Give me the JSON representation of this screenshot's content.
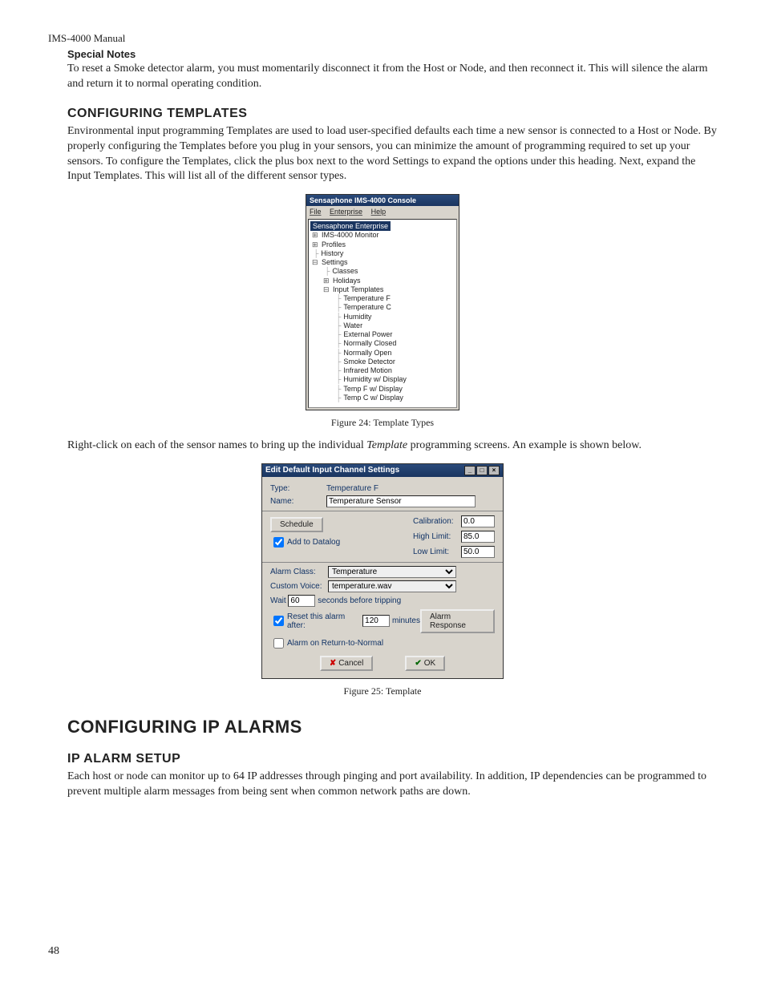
{
  "manualTitle": "IMS-4000 Manual",
  "specialNotes": {
    "heading": "Special Notes",
    "text": "To reset a Smoke detector alarm, you must momentarily disconnect it from the Host or Node, and then reconnect it. This will silence the alarm and return it to normal operating condition."
  },
  "configTemplates": {
    "heading": "CONFIGURING TEMPLATES",
    "text": "Environmental input programming Templates are used to load user-specified defaults each time a new sensor is connected to a Host or Node. By properly configuring the Templates before you plug in your sensors, you can minimize the amount of programming required to set up your sensors. To configure the Templates, click the plus box next to the word Settings to expand the options under this heading. Next, expand the Input Templates. This will list all of the different sensor types."
  },
  "figure24": {
    "windowTitle": "Sensaphone IMS-4000 Console",
    "menus": {
      "file": "File",
      "enterprise": "Enterprise",
      "help": "Help"
    },
    "root": "Sensaphone Enterprise",
    "nodes": {
      "monitor": "IMS-4000 Monitor",
      "profiles": "Profiles",
      "history": "History",
      "settings": "Settings",
      "classes": "Classes",
      "holidays": "Holidays",
      "inputTemplates": "Input Templates",
      "templates": [
        "Temperature F",
        "Temperature C",
        "Humidity",
        "Water",
        "External Power",
        "Normally Closed",
        "Normally Open",
        "Smoke Detector",
        "Infrared Motion",
        "Humidity w/ Display",
        "Temp F w/ Display",
        "Temp C w/ Display"
      ]
    },
    "caption": "Figure 24: Template Types"
  },
  "midText1": "Right-click on each of the sensor names to bring up the individual ",
  "midItalic": "Template",
  "midText2": " programming screens. An example is shown below.",
  "figure25": {
    "windowTitle": "Edit Default Input Channel Settings",
    "typeLabel": "Type:",
    "typeValue": "Temperature F",
    "nameLabel": "Name:",
    "nameValue": "Temperature Sensor",
    "scheduleBtn": "Schedule",
    "addToDatalog": "Add to Datalog",
    "calibrationLabel": "Calibration:",
    "calibrationValue": "0.0",
    "highLimitLabel": "High Limit:",
    "highLimitValue": "85.0",
    "lowLimitLabel": "Low Limit:",
    "lowLimitValue": "50.0",
    "alarmClassLabel": "Alarm Class:",
    "alarmClassValue": "Temperature",
    "customVoiceLabel": "Custom Voice:",
    "customVoiceValue": "temperature.wav",
    "waitLabel": "Wait",
    "waitValue": "60",
    "waitSuffix": "seconds before tripping",
    "resetLabel": "Reset this alarm after:",
    "resetValue": "120",
    "resetSuffix": "minutes",
    "alarmResponseBtn": "Alarm Response",
    "alarmReturnLabel": "Alarm on Return-to-Normal",
    "cancelBtn": "Cancel",
    "okBtn": "OK",
    "caption": "Figure 25: Template"
  },
  "configIP": {
    "heading": "CONFIGURING IP ALARMS",
    "subheading": "IP ALARM SETUP",
    "text": "Each host or node can monitor up to 64 IP addresses through pinging and port availability. In addition, IP dependencies can be programmed to prevent multiple alarm messages from being sent when common network paths are down."
  },
  "pageNumber": "48"
}
